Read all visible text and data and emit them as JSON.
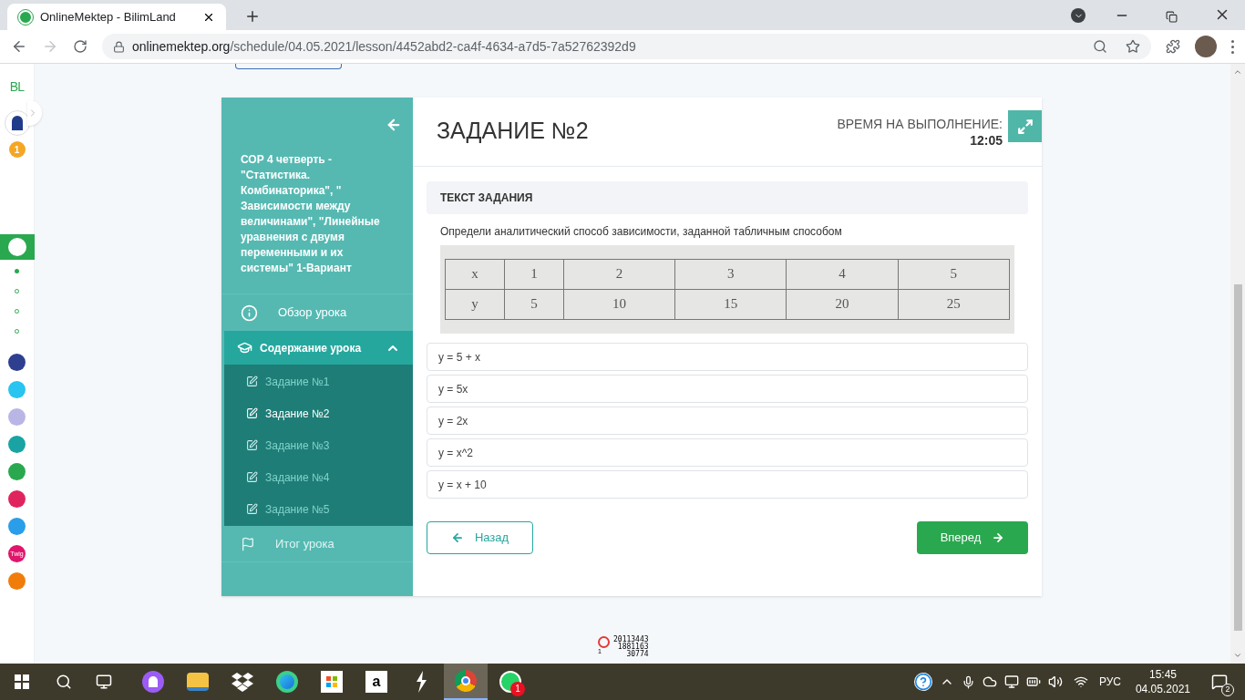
{
  "browser": {
    "tab_title": "OnlineMektep - BilimLand",
    "url_host": "onlinemektep.org",
    "url_path": "/schedule/04.05.2021/lesson/4452abd2-ca4f-4634-a7d5-7a52762392d9"
  },
  "rail": {
    "logo": "BL",
    "badge": "1",
    "steps": [
      {
        "selected": true
      },
      {
        "selected": false
      },
      {
        "selected": false
      },
      {
        "selected": false
      }
    ],
    "apps": [
      {
        "color": "#2f3f8f"
      },
      {
        "color": "#29c4ef"
      },
      {
        "color": "#b9b6e6"
      },
      {
        "color": "#1aa3a3"
      },
      {
        "color": "#2aa84f"
      },
      {
        "color": "#e0245e"
      },
      {
        "color": "#2a9ee8"
      },
      {
        "color": "#e0156b",
        "label": "Twig"
      },
      {
        "color": "#f07d0a"
      }
    ]
  },
  "sidebar": {
    "title": "СОР 4 четверть - \"Статистика. Комбинаторика\", \" Зависимости между величинами\", \"Линейные уравнения с двумя переменными и их системы\" 1-Вариант",
    "overview": "Обзор урока",
    "contents": {
      "label": "Содержание урока",
      "expanded": true
    },
    "tasks": [
      {
        "label": "Задание №1",
        "selected": false
      },
      {
        "label": "Задание №2",
        "selected": true
      },
      {
        "label": "Задание №3",
        "selected": false
      },
      {
        "label": "Задание №4",
        "selected": false
      },
      {
        "label": "Задание №5",
        "selected": false
      }
    ],
    "summary": {
      "label": "Итог урока",
      "disabled": true
    }
  },
  "main": {
    "heading": "ЗАДАНИЕ №2",
    "timer_label": "ВРЕМЯ НА ВЫПОЛНЕНИЕ:",
    "timer_value": "12:05",
    "section_title": "ТЕКСТ ЗАДАНИЯ",
    "question": "Определи аналитический способ зависимости, заданной табличным способом",
    "table": [
      [
        "x",
        "1",
        "2",
        "3",
        "4",
        "5"
      ],
      [
        "y",
        "5",
        "10",
        "15",
        "20",
        "25"
      ]
    ],
    "options": [
      "y = 5 + x",
      "y = 5x",
      "y = 2x",
      "y = x^2",
      "y = x + 10"
    ],
    "back": "Назад",
    "next": "Вперед"
  },
  "counter": {
    "lines": [
      "20113443",
      "1881163",
      "30774"
    ],
    "mark": "1"
  },
  "taskbar": {
    "apps": [
      {
        "kind": "alice",
        "selected": false
      },
      {
        "kind": "explorer",
        "selected": false
      },
      {
        "kind": "dropbox",
        "selected": false
      },
      {
        "kind": "edge",
        "selected": false
      },
      {
        "kind": "store",
        "selected": false
      },
      {
        "kind": "amazon",
        "glyph": "a",
        "selected": false
      },
      {
        "kind": "bolt",
        "selected": false
      },
      {
        "kind": "chrome",
        "selected": true
      },
      {
        "kind": "whatsapp",
        "selected": false,
        "badge": "1"
      }
    ],
    "language": "РУС",
    "time": "15:45",
    "date": "04.05.2021",
    "notifications": "2"
  }
}
